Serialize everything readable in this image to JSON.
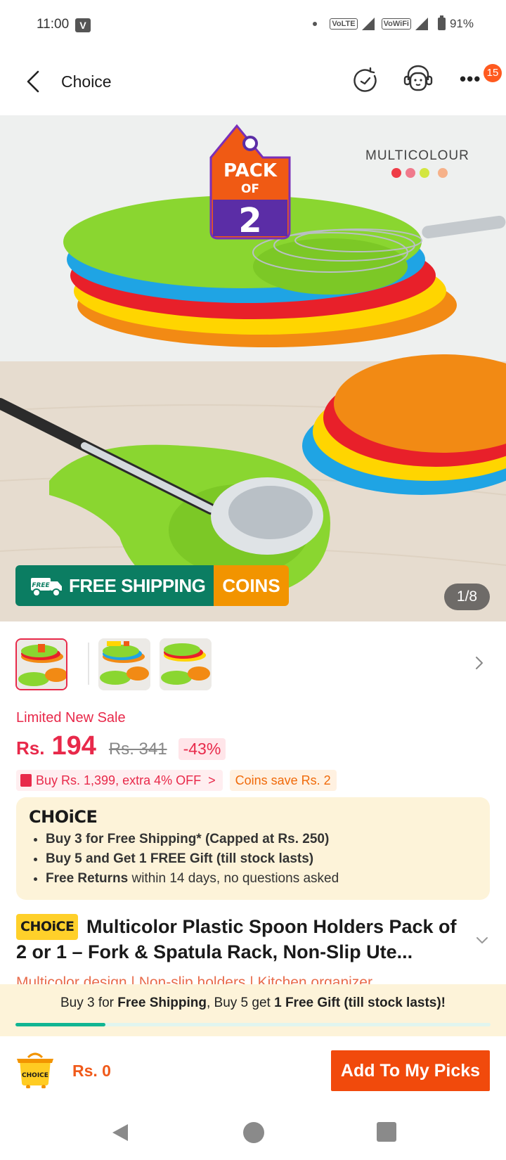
{
  "status_bar": {
    "time": "11:00",
    "v_badge": "V",
    "net1": "VoLTE",
    "net2": "VoWiFi",
    "battery": "91%"
  },
  "header": {
    "title": "Choice",
    "notification_count": "15",
    "icons": [
      "back-icon",
      "refresh-icon",
      "support-icon",
      "more-icon"
    ]
  },
  "hero": {
    "pack_label": [
      "PACK",
      "OF",
      "2"
    ],
    "multicolour_label": "MULTICOLOUR",
    "swatches": [
      "#ef3c47",
      "#f07a8c",
      "#d3e640",
      "#f6b189"
    ],
    "free_badge": "FREE",
    "free_shipping": "FREE SHIPPING",
    "coins": "COINS",
    "page_counter": "1/8"
  },
  "price": {
    "sale_label": "Limited New Sale",
    "currency": "Rs.",
    "current": "194",
    "original": "Rs. 341",
    "discount": "-43%"
  },
  "promos": {
    "bundle": "Buy Rs. 1,399, extra 4% OFF",
    "bundle_chevron": ">",
    "coins": "Coins save Rs. 2"
  },
  "choice_box": {
    "logo": "CHOiCE",
    "line1": "Buy 3 for  Free Shipping* (Capped at Rs. 250)",
    "line2": "Buy 5 and Get 1 FREE Gift (till stock lasts)",
    "line3_bold": "Free Returns",
    "line3_rest": " within 14 days, no questions asked"
  },
  "product": {
    "badge": "CHOiCE",
    "title": "Multicolor Plastic Spoon Holders Pack of 2 or 1 – Fork & Spatula Rack, Non-Slip Ute...",
    "tags": "Multicolor design  |  Non-slip holders  |  Kitchen organizer"
  },
  "bottom_promo": {
    "part1": "Buy 3 for ",
    "part2": "Free Shipping",
    "part3": ", Buy 5 get ",
    "part4": "1 Free Gift (till stock lasts)!",
    "progress": 0.19
  },
  "action_bar": {
    "cart_label": "CHOICE",
    "total": "Rs. 0",
    "add_button": "Add To My Picks"
  }
}
